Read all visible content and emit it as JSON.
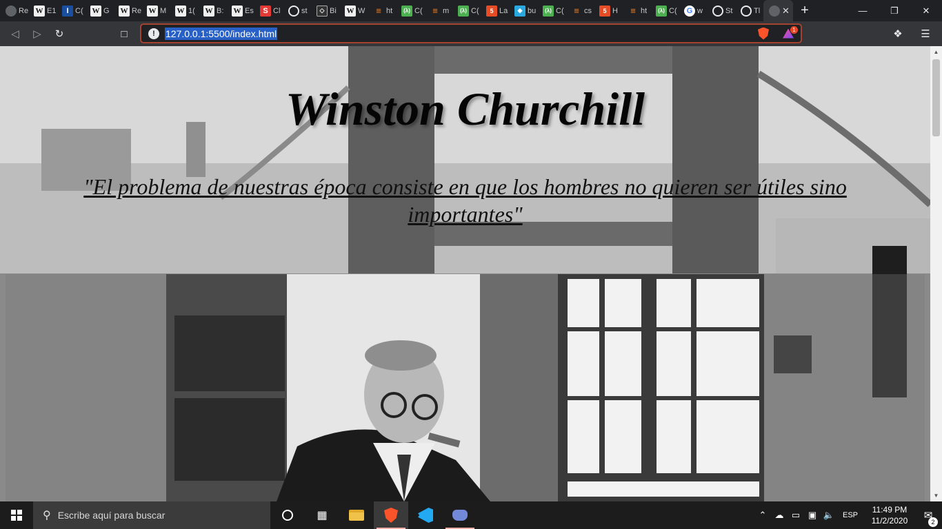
{
  "browser": {
    "tabs": [
      {
        "label": "Re",
        "icon": "globe-icon"
      },
      {
        "label": "E1",
        "icon": "wikipedia-icon"
      },
      {
        "label": "C(",
        "icon": "i-icon"
      },
      {
        "label": "G",
        "icon": "wikipedia-icon"
      },
      {
        "label": "Re",
        "icon": "wikipedia-icon"
      },
      {
        "label": "M",
        "icon": "wikipedia-icon"
      },
      {
        "label": "1(",
        "icon": "wikipedia-icon"
      },
      {
        "label": "B:",
        "icon": "wikipedia-icon"
      },
      {
        "label": "Es",
        "icon": "wikipedia-icon"
      },
      {
        "label": "Cl",
        "icon": "s-icon"
      },
      {
        "label": "st",
        "icon": "github-icon"
      },
      {
        "label": "Bi",
        "icon": "box-icon"
      },
      {
        "label": "W",
        "icon": "wikipedia-icon"
      },
      {
        "label": "ht",
        "icon": "stackoverflow-icon"
      },
      {
        "label": "C(",
        "icon": "freecodecamp-icon"
      },
      {
        "label": "m",
        "icon": "stackoverflow-icon"
      },
      {
        "label": "C(",
        "icon": "freecodecamp-icon"
      },
      {
        "label": "La",
        "icon": "html5-icon"
      },
      {
        "label": "bu",
        "icon": "css-icon"
      },
      {
        "label": "C(",
        "icon": "freecodecamp-icon"
      },
      {
        "label": "cs",
        "icon": "stackoverflow-icon"
      },
      {
        "label": "H",
        "icon": "html5-icon"
      },
      {
        "label": "ht",
        "icon": "stackoverflow-icon"
      },
      {
        "label": "C(",
        "icon": "freecodecamp-icon"
      },
      {
        "label": "w",
        "icon": "google-icon"
      },
      {
        "label": "St",
        "icon": "github-icon"
      },
      {
        "label": "Tl",
        "icon": "github-icon"
      }
    ],
    "active_tab_close": "✕",
    "new_tab": "+",
    "url": "127.0.0.1:5500/index.html",
    "brave_badge": "1"
  },
  "page": {
    "title": "Winston Churchill",
    "quote": "\"El problema de nuestras época consiste en que los hombres no quieren ser útiles sino importantes\""
  },
  "taskbar": {
    "search_placeholder": "Escribe aquí para buscar",
    "language": "ESP",
    "time": "11:49 PM",
    "date": "11/2/2020",
    "notifications": "2"
  }
}
